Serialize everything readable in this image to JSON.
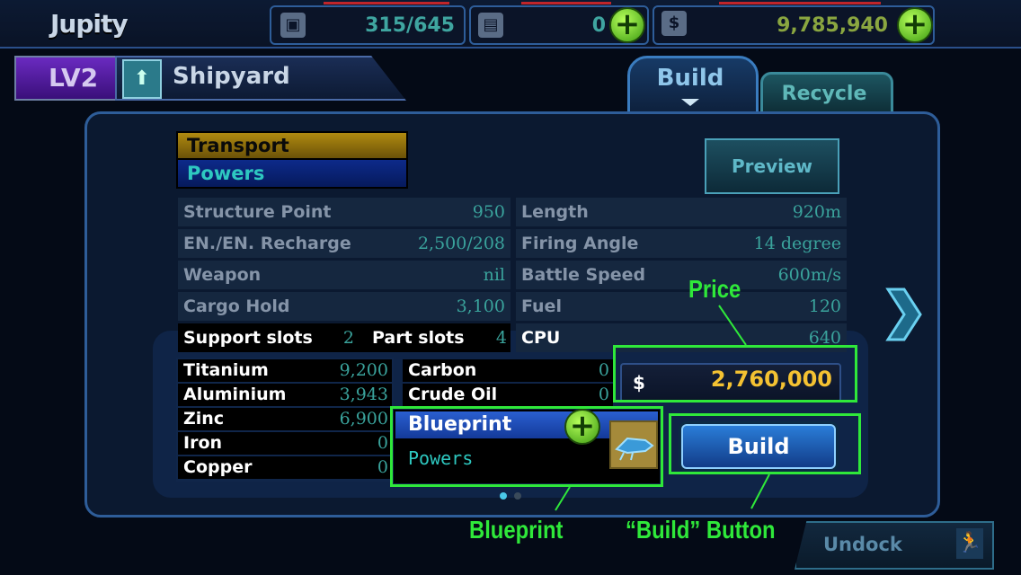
{
  "header": {
    "app_title": "Jupity",
    "cargo": "315/645",
    "storage": "0",
    "money": "9,785,940",
    "icons": [
      "cube-icon",
      "floppy-icon",
      "dollar-icon"
    ]
  },
  "level": {
    "label": "LV2",
    "building": "Shipyard"
  },
  "tabs": [
    {
      "label": "Build",
      "active": true
    },
    {
      "label": "Recycle",
      "active": false
    }
  ],
  "categories": [
    "Transport",
    "Powers"
  ],
  "preview_label": "Preview",
  "stats_left": [
    {
      "key": "Structure Point",
      "val": "950"
    },
    {
      "key": "EN./EN. Recharge",
      "val": "2,500/208"
    },
    {
      "key": "Weapon",
      "val": "nil"
    },
    {
      "key": "Cargo Hold",
      "val": "3,100"
    }
  ],
  "slots": {
    "support_key": "Support slots",
    "support_val": "2",
    "part_key": "Part slots",
    "part_val": "4"
  },
  "stats_right": [
    {
      "key": "Length",
      "val": "920m"
    },
    {
      "key": "Firing Angle",
      "val": "14 degree"
    },
    {
      "key": "Battle Speed",
      "val": "600m/s"
    },
    {
      "key": "Fuel",
      "val": "120"
    },
    {
      "key": "CPU",
      "val": "640"
    }
  ],
  "materials_left": [
    {
      "key": "Titanium",
      "val": "9,200"
    },
    {
      "key": "Aluminium",
      "val": "3,943"
    },
    {
      "key": "Zinc",
      "val": "6,900"
    },
    {
      "key": "Iron",
      "val": "0"
    },
    {
      "key": "Copper",
      "val": "0"
    }
  ],
  "materials_right": [
    {
      "key": "Carbon",
      "val": "0"
    },
    {
      "key": "Crude Oil",
      "val": "0"
    }
  ],
  "price": {
    "currency": "$",
    "value": "2,760,000"
  },
  "blueprint": {
    "title": "Blueprint",
    "value": "Powers"
  },
  "build_label": "Build",
  "undock_label": "Undock",
  "callouts": {
    "price": "Price",
    "blueprint": "Blueprint",
    "build": "“Build” Button"
  },
  "colors": {
    "highlight": "#2fe83a",
    "price": "#f4c232",
    "accent": "#2ec8c0"
  }
}
